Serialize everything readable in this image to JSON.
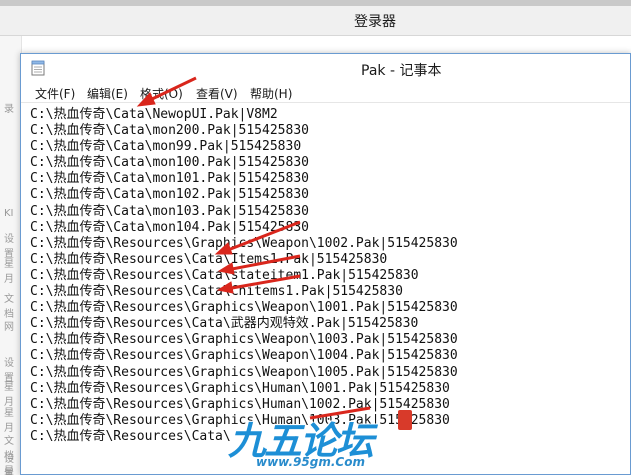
{
  "background_window": {
    "title": "登录器",
    "side_labels": [
      "录",
      "KI",
      "设置",
      "星月",
      "文档",
      "网",
      "设置",
      "星月",
      "星月",
      "文档",
      "设置",
      "星月"
    ]
  },
  "notepad": {
    "title": "Pak - 记事本",
    "menu": [
      {
        "id": "file",
        "label": "文件(F)"
      },
      {
        "id": "edit",
        "label": "编辑(E)"
      },
      {
        "id": "format",
        "label": "格式(O)"
      },
      {
        "id": "view",
        "label": "查看(V)"
      },
      {
        "id": "help",
        "label": "帮助(H)"
      }
    ],
    "lines": [
      "C:\\热血传奇\\Cata\\NewopUI.Pak|V8M2",
      "C:\\热血传奇\\Cata\\mon200.Pak|515425830",
      "C:\\热血传奇\\Cata\\mon99.Pak|515425830",
      "C:\\热血传奇\\Cata\\mon100.Pak|515425830",
      "C:\\热血传奇\\Cata\\mon101.Pak|515425830",
      "C:\\热血传奇\\Cata\\mon102.Pak|515425830",
      "C:\\热血传奇\\Cata\\mon103.Pak|515425830",
      "C:\\热血传奇\\Cata\\mon104.Pak|515425830",
      "C:\\热血传奇\\Resources\\Graphics\\Weapon\\1002.Pak|515425830",
      "C:\\热血传奇\\Resources\\Cata\\Items1.Pak|515425830",
      "C:\\热血传奇\\Resources\\Cata\\stateitem1.Pak|515425830",
      "C:\\热血传奇\\Resources\\Cata\\Chitems1.Pak|515425830",
      "C:\\热血传奇\\Resources\\Graphics\\Weapon\\1001.Pak|515425830",
      "C:\\热血传奇\\Resources\\Cata\\武器内观特效.Pak|515425830",
      "C:\\热血传奇\\Resources\\Graphics\\Weapon\\1003.Pak|515425830",
      "C:\\热血传奇\\Resources\\Graphics\\Weapon\\1004.Pak|515425830",
      "C:\\热血传奇\\Resources\\Graphics\\Weapon\\1005.Pak|515425830",
      "C:\\热血传奇\\Resources\\Graphics\\Human\\1001.Pak|515425830",
      "C:\\热血传奇\\Resources\\Graphics\\Human\\1002.Pak|515425830",
      "C:\\热血传奇\\Resources\\Graphics\\Human\\1003.Pak|515425830",
      "C:\\热血传奇\\Resources\\Cata\\"
    ]
  },
  "watermark": {
    "logo": "九五论坛",
    "url": "www.95gm.Com"
  },
  "colors": {
    "arrow": "#d9261c",
    "window_border": "#6a9bd1",
    "watermark_blue": "#1d8fd6"
  },
  "icons": {
    "notepad": "notepad-icon",
    "arrow": "red-arrow-annotation"
  }
}
